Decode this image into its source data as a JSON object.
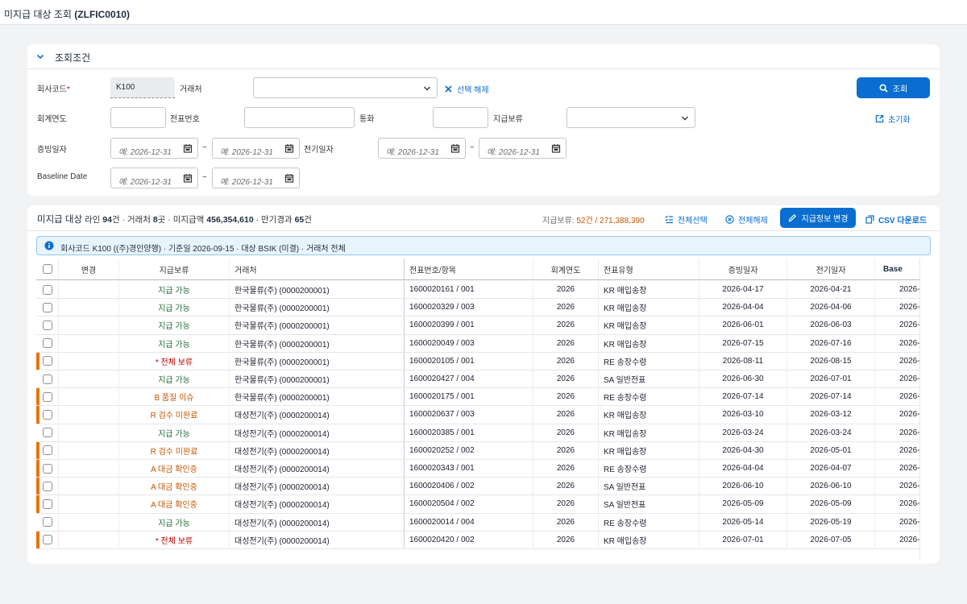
{
  "app": {
    "title_prefix": "미지급 대상 조회 ",
    "title_code": "(ZLFIC0010)"
  },
  "filter": {
    "header": "조회조건",
    "company_code_label": "회사코드",
    "required_mark": "*",
    "company_code_value": "K100",
    "vendor_label": "거래처",
    "clear_selection": "선택 해제",
    "search_button": "조회",
    "fiscal_year_label": "회계연도",
    "doc_no_label": "전표번호",
    "currency_label": "통화",
    "payment_block_label": "지급보류",
    "reset": "초기화",
    "doc_date_label": "증빙일자",
    "posting_date_label": "전기일자",
    "baseline_label": "Baseline Date",
    "date_placeholder": "예: 2026-12-31",
    "range_sep": "~"
  },
  "results": {
    "title": "미지급 대상",
    "s1": "라인 ",
    "lines": "94",
    "s2": "건 · 거래처 ",
    "vendors": "8",
    "s3": "곳 · 미지급액 ",
    "amount": "456,354,610",
    "s4": " · 만기경과 ",
    "overdue": "65",
    "s5": "건",
    "hold_label": "지급보류: ",
    "hold_value": "52건 / 271,388,390",
    "select_all": "전체선택",
    "deselect_all": "전체해제",
    "change_button": "지급정보 변경",
    "csv_button": "CSV 다운로드",
    "info": "회사코드 K100 ((주)경인양행) · 기준일 2026-09-15 · 대상 BSIK (미결) · 거래처 전체"
  },
  "table": {
    "headers": [
      "변경",
      "지급보류",
      "거래처",
      "전표번호/항목",
      "회계연도",
      "전표유형",
      "증빙일자",
      "전기일자",
      "Base"
    ],
    "rows": [
      {
        "hold": "지급 가능",
        "status": "ok",
        "vendor": "한국물류(주) (0000200001)",
        "doc": "1600020161 / 001",
        "year": "2026",
        "type": "KR 매입송장",
        "docdate": "2026-04-17",
        "postdate": "2026-04-21",
        "base": "2026-"
      },
      {
        "hold": "지급 가능",
        "status": "ok",
        "vendor": "한국물류(주) (0000200001)",
        "doc": "1600020329 / 003",
        "year": "2026",
        "type": "KR 매입송장",
        "docdate": "2026-04-04",
        "postdate": "2026-04-06",
        "base": "2026-"
      },
      {
        "hold": "지급 가능",
        "status": "ok",
        "vendor": "한국물류(주) (0000200001)",
        "doc": "1600020399 / 001",
        "year": "2026",
        "type": "KR 매입송장",
        "docdate": "2026-06-01",
        "postdate": "2026-06-03",
        "base": "2026-"
      },
      {
        "hold": "지급 가능",
        "status": "ok",
        "vendor": "한국물류(주) (0000200001)",
        "doc": "1600020049 / 003",
        "year": "2026",
        "type": "KR 매입송장",
        "docdate": "2026-07-15",
        "postdate": "2026-07-16",
        "base": "2026-"
      },
      {
        "hold": "* 전체 보류",
        "status": "x",
        "vendor": "한국물류(주) (0000200001)",
        "doc": "1600020105 / 001",
        "year": "2026",
        "type": "RE 송장수령",
        "docdate": "2026-08-11",
        "postdate": "2026-08-15",
        "base": "2026-"
      },
      {
        "hold": "지급 가능",
        "status": "ok",
        "vendor": "한국물류(주) (0000200001)",
        "doc": "1600020427 / 004",
        "year": "2026",
        "type": "SA 일반전표",
        "docdate": "2026-06-30",
        "postdate": "2026-07-01",
        "base": "2026-"
      },
      {
        "hold": "B 품질 이슈",
        "status": "w",
        "vendor": "한국물류(주) (0000200001)",
        "doc": "1600020175 / 001",
        "year": "2026",
        "type": "RE 송장수령",
        "docdate": "2026-07-14",
        "postdate": "2026-07-14",
        "base": "2026-"
      },
      {
        "hold": "R 검수 미완료",
        "status": "w",
        "vendor": "대성전기(주) (0000200014)",
        "doc": "1600020637 / 003",
        "year": "2026",
        "type": "KR 매입송장",
        "docdate": "2026-03-10",
        "postdate": "2026-03-12",
        "base": "2026-"
      },
      {
        "hold": "지급 가능",
        "status": "ok",
        "vendor": "대성전기(주) (0000200014)",
        "doc": "1600020385 / 001",
        "year": "2026",
        "type": "KR 매입송장",
        "docdate": "2026-03-24",
        "postdate": "2026-03-24",
        "base": "2026-"
      },
      {
        "hold": "R 검수 미완료",
        "status": "w",
        "vendor": "대성전기(주) (0000200014)",
        "doc": "1600020252 / 002",
        "year": "2026",
        "type": "KR 매입송장",
        "docdate": "2026-04-30",
        "postdate": "2026-05-01",
        "base": "2026-"
      },
      {
        "hold": "A 대금 확인중",
        "status": "w",
        "vendor": "대성전기(주) (0000200014)",
        "doc": "1600020343 / 001",
        "year": "2026",
        "type": "RE 송장수령",
        "docdate": "2026-04-04",
        "postdate": "2026-04-07",
        "base": "2026-"
      },
      {
        "hold": "A 대금 확인중",
        "status": "w",
        "vendor": "대성전기(주) (0000200014)",
        "doc": "1600020406 / 002",
        "year": "2026",
        "type": "SA 일반전표",
        "docdate": "2026-06-10",
        "postdate": "2026-06-10",
        "base": "2026-"
      },
      {
        "hold": "A 대금 확인중",
        "status": "w",
        "vendor": "대성전기(주) (0000200014)",
        "doc": "1600020504 / 002",
        "year": "2026",
        "type": "SA 일반전표",
        "docdate": "2026-05-09",
        "postdate": "2026-05-09",
        "base": "2026-"
      },
      {
        "hold": "지급 가능",
        "status": "ok",
        "vendor": "대성전기(주) (0000200014)",
        "doc": "1600020014 / 004",
        "year": "2026",
        "type": "RE 송장수령",
        "docdate": "2026-05-14",
        "postdate": "2026-05-19",
        "base": "2026-"
      },
      {
        "hold": "* 전체 보류",
        "status": "x",
        "vendor": "대성전기(주) (0000200014)",
        "doc": "1600020420 / 002",
        "year": "2026",
        "type": "KR 매입송장",
        "docdate": "2026-07-01",
        "postdate": "2026-07-05",
        "base": "2026-"
      }
    ]
  },
  "colors": {
    "accent": "#0a6ed1",
    "ok": "#256f3a",
    "blocked": "#bb0000",
    "warning": "#c35500",
    "row_marker": "#e9730c"
  },
  "icons": {
    "collapse": "chevron-down-icon",
    "dropdown": "chevron-down-icon",
    "clear": "close-icon",
    "search": "search-icon",
    "reset": "reset-icon",
    "calendar": "calendar-icon",
    "select_all": "list-check-icon",
    "deselect_all": "circle-x-icon",
    "edit": "pencil-icon",
    "csv": "export-icon",
    "info": "info-icon"
  }
}
